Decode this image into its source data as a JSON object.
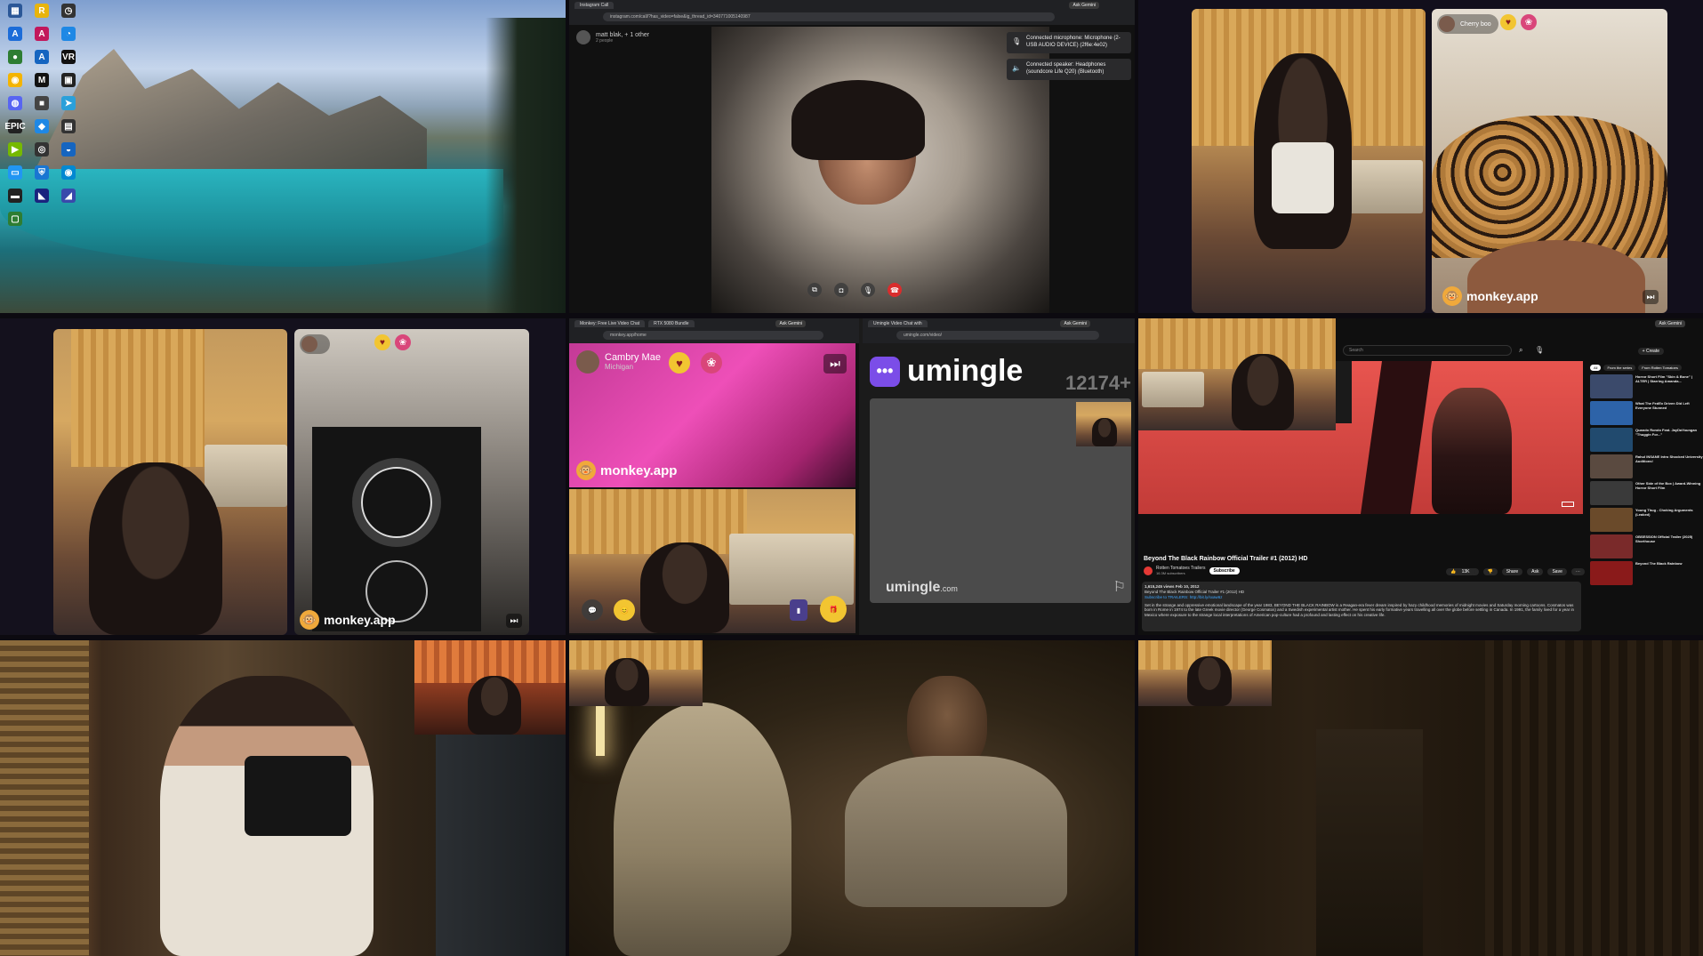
{
  "desktop": {
    "icons": [
      {
        "label": "",
        "glyph": "▦",
        "color": "#2b5797"
      },
      {
        "label": "",
        "glyph": "R",
        "color": "#e8b40c"
      },
      {
        "label": "",
        "glyph": "◷",
        "color": "#333333"
      },
      {
        "label": "",
        "glyph": "A",
        "color": "#1c6cd8"
      },
      {
        "label": "",
        "glyph": "A",
        "color": "#c2185b"
      },
      {
        "label": "",
        "glyph": "◔",
        "color": "#1e88e5"
      },
      {
        "label": "",
        "glyph": "●",
        "color": "#2e7d32"
      },
      {
        "label": "",
        "glyph": "A",
        "color": "#1565c0"
      },
      {
        "label": "",
        "glyph": "VR",
        "color": "#111111"
      },
      {
        "label": "",
        "glyph": "◉",
        "color": "#f4b400"
      },
      {
        "label": "",
        "glyph": "M",
        "color": "#111111"
      },
      {
        "label": "",
        "glyph": "▣",
        "color": "#222222"
      },
      {
        "label": "",
        "glyph": "◍",
        "color": "#5865f2"
      },
      {
        "label": "",
        "glyph": "■",
        "color": "#444444"
      },
      {
        "label": "",
        "glyph": "➤",
        "color": "#2aa0da"
      },
      {
        "label": "",
        "glyph": "EPIC",
        "color": "#222222"
      },
      {
        "label": "",
        "glyph": "◆",
        "color": "#1e88e5"
      },
      {
        "label": "",
        "glyph": "▤",
        "color": "#333333"
      },
      {
        "label": "",
        "glyph": "▶",
        "color": "#76b900"
      },
      {
        "label": "",
        "glyph": "◎",
        "color": "#333333"
      },
      {
        "label": "",
        "glyph": "◒",
        "color": "#1565c0"
      },
      {
        "label": "",
        "glyph": "▭",
        "color": "#2196f3"
      },
      {
        "label": "",
        "glyph": "⛨",
        "color": "#1976d2"
      },
      {
        "label": "",
        "glyph": "◉",
        "color": "#0288d1"
      },
      {
        "label": "",
        "glyph": "▬",
        "color": "#222222"
      },
      {
        "label": "",
        "glyph": "◣",
        "color": "#1a237e"
      },
      {
        "label": "",
        "glyph": "◢",
        "color": "#3949ab"
      },
      {
        "label": "",
        "glyph": "▢",
        "color": "#2e7d32"
      }
    ]
  },
  "instagram_call": {
    "tab": "Instagram Call",
    "url": "instagram.com/call/?has_video=false&ig_thread_id=340771005140987",
    "ask_gemini": "Ask Gemini",
    "caller_name": "matt blak, + 1 other",
    "caller_sub": "2 people",
    "notif_mic": "Connected microphone: Microphone (2- USB AUDIO DEVICE) (2f6e:4e02)",
    "notif_speaker": "Connected speaker: Headphones (soundcore Life Q20) (Bluetooth)"
  },
  "monkey_top": {
    "user_name": "Cherry boo",
    "user_sub": "",
    "brand": "monkey.app"
  },
  "monkey_mid": {
    "user_name": "",
    "brand": "monkey.app"
  },
  "monkey_browser": {
    "tab1": "Monkey: Free Live Video Chat",
    "tab2": "RTX 5080 Bundle",
    "url": "monkey.app/home",
    "ask_gemini": "Ask Gemini",
    "user_name": "Cambry Mae",
    "user_sub": "Michigan",
    "brand": "monkey.app"
  },
  "umingle": {
    "tab": "Umingle Video Chat with",
    "url": "umingle.com/video/",
    "ask_gemini": "Ask Gemini",
    "logo": "umingle",
    "count": "12174+",
    "brand_main": "umingle",
    "brand_tld": ".com"
  },
  "youtube": {
    "search_placeholder": "Search",
    "create": "+ Create",
    "title": "Beyond The Black Rainbow Official Trailer #1 (2012) HD",
    "channel": "Rotten Tomatoes Trailers",
    "subs": "16.3M subscribers",
    "subscribe": "Subscribe",
    "likes": "13K",
    "share": "Share",
    "ask": "Ask",
    "save": "Save",
    "desc_meta": "1,615,245 views  Feb 10, 2012",
    "desc_line1": "Beyond The Black Rainbow Official Trailer #1 (2012) HD",
    "desc_line2": "Subscribe to TRAILERS: http://bit.ly/sxaw6z",
    "desc_body": "Set in the strange and oppressive emotional landscape of the year 1983, BEYOND THE BLACK RAINBOW is a Reagan-era fever dream inspired by hazy childhood memories of midnight movies and Saturday morning cartoons. Cosmatos was born in Rome in 1974 to the late Greek movie director (George Cosmatos) and a Swedish experimental artist mother. He spent his early formative years travelling all over the globe before settling in Canada. In 1991, the family lived for a year in Mexico where exposure to the strange local interpretations of American pop-culture had a profound and lasting effect on his creative life.",
    "chip_all": "All",
    "chip_series": "From the series",
    "chip_channel": "From Rotten Tomatoes",
    "side": [
      {
        "title": "Horror Short Film \"Skin & Bone\" | ALTER | Starring Amanda...",
        "color": "#3b4a6b"
      },
      {
        "title": "What The FedEx Driven Did Left Everyone Stunned",
        "color": "#2d63a8"
      },
      {
        "title": "Quando Rondo Feat. JayDaYoungan \"Thuggin For...\"",
        "color": "#214a6e"
      },
      {
        "title": "Rahul INSANE Intro Shocked University Auditions!",
        "color": "#5a4a40"
      },
      {
        "title": "Other Side of the Box | Award-Winning Horror Short Film",
        "color": "#3a3a3a"
      },
      {
        "title": "Young Thug - Choking Arguments (Leaked)",
        "color": "#6a4a2a"
      },
      {
        "title": "OBSESSION Official Trailer (2025) Shorthouse",
        "color": "#7a2a2a"
      },
      {
        "title": "Beyond The Black Rainbow",
        "color": "#8a1a1a"
      }
    ]
  }
}
